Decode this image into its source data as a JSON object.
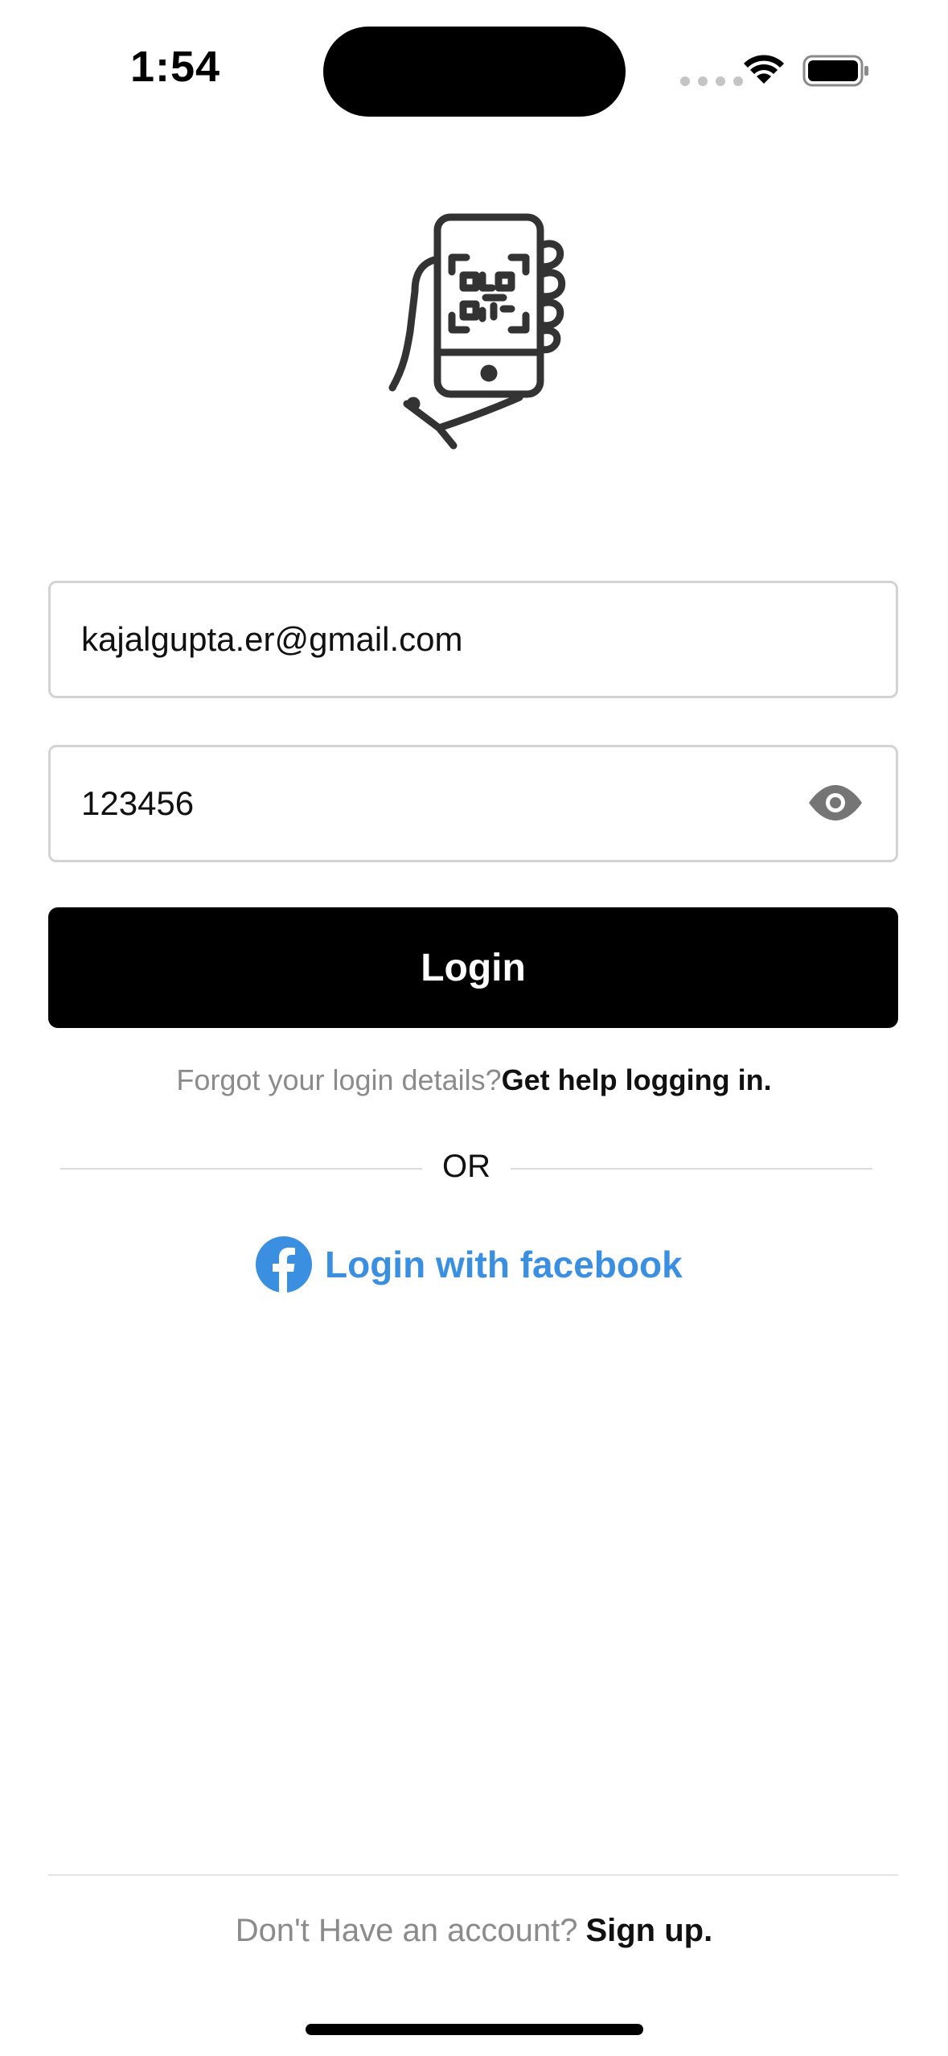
{
  "status_bar": {
    "time": "1:54"
  },
  "login_form": {
    "email_value": "kajalgupta.er@gmail.com",
    "password_value": "123456",
    "login_label": "Login"
  },
  "help": {
    "prompt": "Forgot your login details?",
    "link": "Get help logging in."
  },
  "divider": {
    "or_label": "OR"
  },
  "facebook": {
    "label": "Login with facebook",
    "color": "#3b8fe0"
  },
  "signup": {
    "prompt": "Don't Have an account?",
    "link": "Sign up."
  },
  "icons": {
    "logo": "hand-holding-phone-qr-icon",
    "password_toggle": "eye-icon",
    "facebook": "facebook-icon"
  }
}
